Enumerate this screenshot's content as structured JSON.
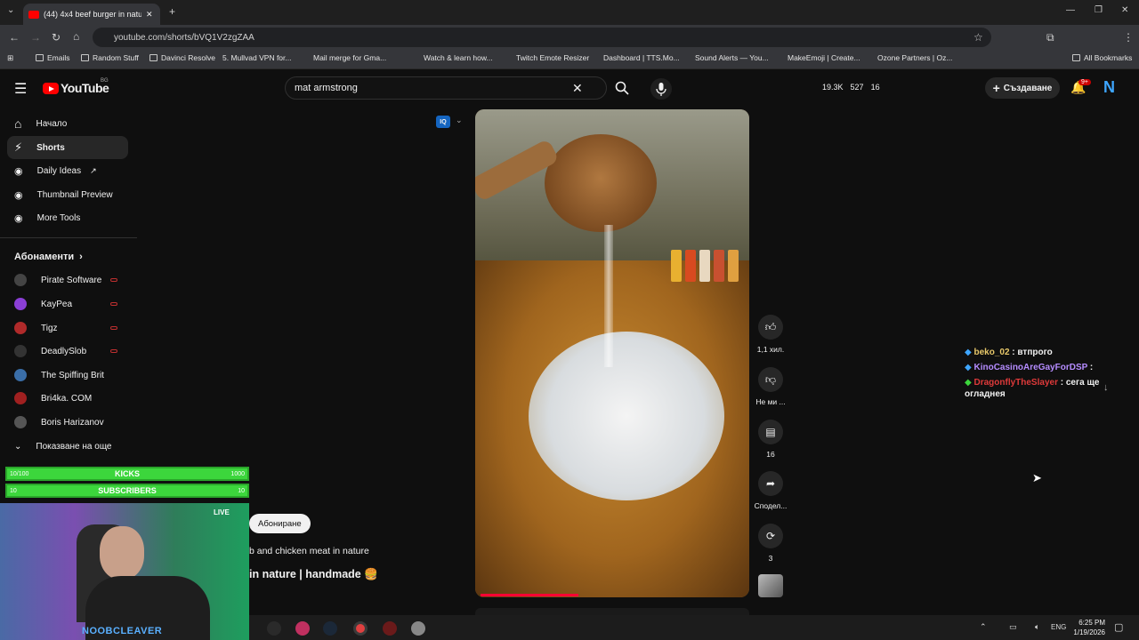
{
  "browser": {
    "tab_title": "(44) 4x4 beef burger in natu",
    "url": "youtube.com/shorts/bVQ1V2zgZAA",
    "bookmarks": [
      "Emails",
      "Random Stuff",
      "Davinci Resolve",
      "5. Mullvad VPN for...",
      "Mail merge for Gma...",
      "Watch & learn how...",
      "Twitch Emote Resizer",
      "Dashboard | TTS.Mo...",
      "Sound Alerts — You...",
      "MakeEmoji | Create...",
      "Ozone Partners | Oz..."
    ],
    "all_bookmarks": "All Bookmarks"
  },
  "header": {
    "logo": "YouTube",
    "country": "BG",
    "search_value": "mat armstrong",
    "stats": [
      "19.3K",
      "527",
      "16"
    ],
    "create_label": "Създаване",
    "notif_count": "9+",
    "avatar_letter": "N"
  },
  "sidebar": {
    "items": [
      {
        "label": "Начало"
      },
      {
        "label": "Shorts"
      },
      {
        "label": "Daily Ideas"
      },
      {
        "label": "Thumbnail Preview"
      },
      {
        "label": "More Tools"
      }
    ],
    "subs_title": "Абонаменти",
    "subscriptions": [
      {
        "name": "Pirate Software",
        "color": "#444"
      },
      {
        "name": "KayPea",
        "color": "#8b3fd6"
      },
      {
        "name": "Tigz",
        "color": "#b02a2a"
      },
      {
        "name": "DeadlySlob",
        "color": "#333"
      },
      {
        "name": "The Spiffing Brit",
        "color": "#3a6ea8"
      },
      {
        "name": "Bri4ka. COM",
        "color": "#a02020"
      },
      {
        "name": "Boris Harizanov",
        "color": "#555"
      }
    ],
    "show_more": "Показване на още"
  },
  "overlay": {
    "kicks": {
      "left": "10/100",
      "label": "KICKS",
      "right": "1000"
    },
    "subs": {
      "left": "10",
      "label": "SUBSCRIBERS",
      "right": "10"
    },
    "live": "LIVE",
    "streamer": "NOOBCLEAVER"
  },
  "short": {
    "subscribe": "Абониране",
    "desc": "b and chicken meat in nature",
    "title": "in nature | handmade 🍔",
    "actions": {
      "likes": "1,1 хил.",
      "dislike": "Не ми ...",
      "comments": "16",
      "share": "Сподел...",
      "remix": "3"
    }
  },
  "chat": [
    {
      "user": "beko_02",
      "user_color": "#e8c86a",
      "msg": ": втпрого"
    },
    {
      "user": "KinoCasinoAreGayForDSP",
      "user_color": "#b58cff",
      "msg": ":"
    },
    {
      "user": "DragonflyTheSlayer",
      "user_color": "#e03a3a",
      "msg": ": сега ще огладнея"
    }
  ],
  "taskbar": {
    "lang": "ENG",
    "time": "6:25 PM",
    "date": "1/19/2026"
  }
}
